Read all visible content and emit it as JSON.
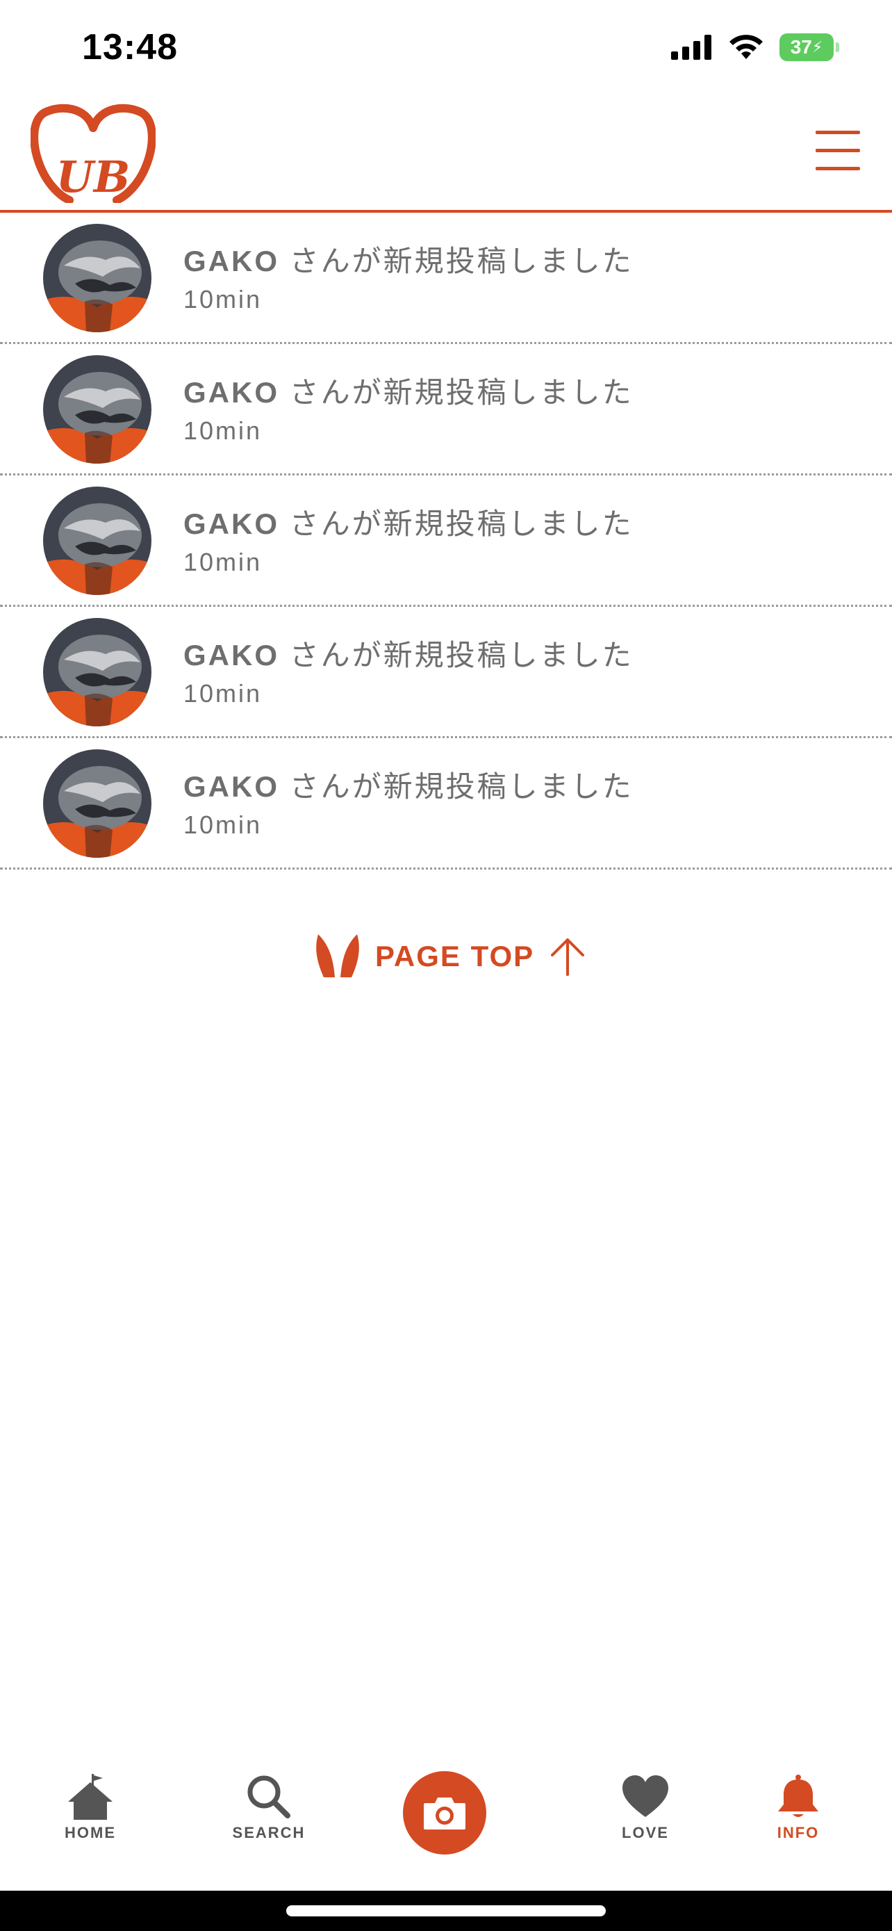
{
  "status_bar": {
    "time": "13:48",
    "battery": "37",
    "icons": [
      "signal-icon",
      "wifi-icon",
      "battery-icon"
    ]
  },
  "header": {
    "logo_text": "UB",
    "menu_icon": "hamburger-menu-icon"
  },
  "feed": {
    "items": [
      {
        "name": "GAKO",
        "message": " さんが新規投稿しました",
        "time": "10min"
      },
      {
        "name": "GAKO",
        "message": " さんが新規投稿しました",
        "time": "10min"
      },
      {
        "name": "GAKO",
        "message": " さんが新規投稿しました",
        "time": "10min"
      },
      {
        "name": "GAKO",
        "message": " さんが新規投稿しました",
        "time": "10min"
      },
      {
        "name": "GAKO",
        "message": " さんが新規投稿しました",
        "time": "10min"
      }
    ]
  },
  "page_top": {
    "label": "PAGE TOP"
  },
  "nav": {
    "home": "HOME",
    "search": "SEARCH",
    "love": "LOVE",
    "info": "INFO",
    "active": "info"
  },
  "colors": {
    "accent": "#d44a22",
    "text": "#6e6e6e",
    "battery": "#5ecb5e"
  }
}
